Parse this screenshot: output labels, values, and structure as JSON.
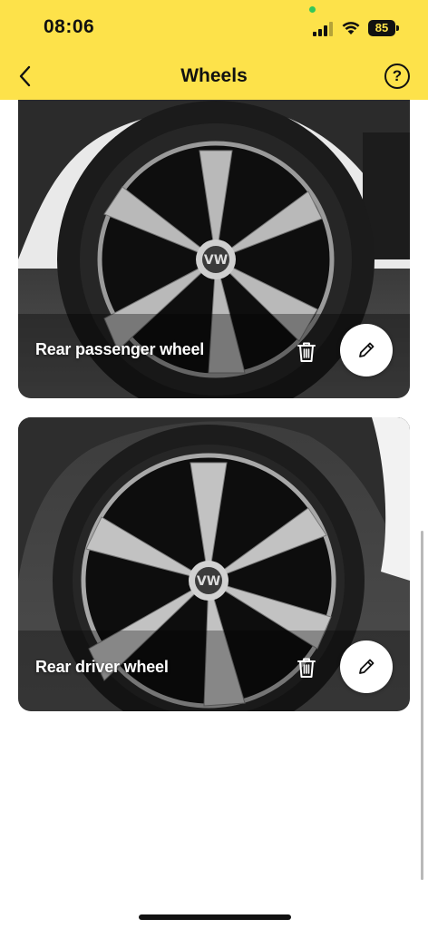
{
  "status_bar": {
    "time": "08:06",
    "battery": "85",
    "icons": [
      "cellular-signal-icon",
      "wifi-icon",
      "battery-icon"
    ]
  },
  "header": {
    "title": "Wheels",
    "back_icon": "chevron-left-icon",
    "help_label": "?",
    "background_color": "#fde24a"
  },
  "wheels": [
    {
      "label": "Rear passenger wheel",
      "delete_icon": "trash-icon",
      "edit_icon": "pencil-icon"
    },
    {
      "label": "Rear driver wheel",
      "delete_icon": "trash-icon",
      "edit_icon": "pencil-icon"
    }
  ]
}
